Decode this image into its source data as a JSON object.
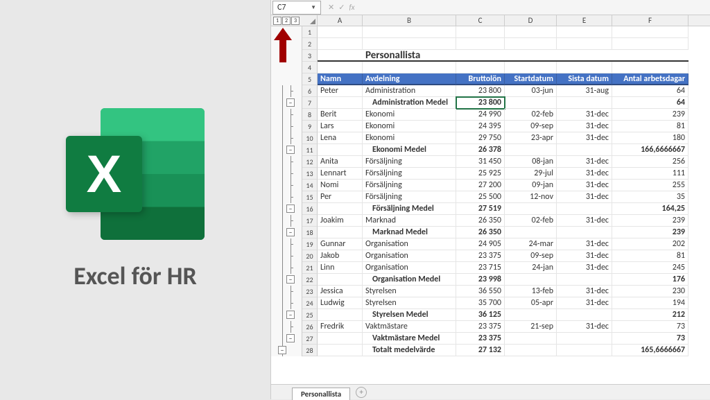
{
  "title": "Excel för HR",
  "logo_letter": "X",
  "namebox": "C7",
  "fx": {
    "cancel": "✕",
    "confirm": "✓",
    "fx": "fx"
  },
  "outline_levels": [
    "1",
    "2",
    "3"
  ],
  "columns": [
    "A",
    "B",
    "C",
    "D",
    "E",
    "F"
  ],
  "sheet_title": "Personallista",
  "headers": {
    "namn": "Namn",
    "avd": "Avdelning",
    "brutto": "Bruttolön",
    "start": "Startdatum",
    "sista": "Sista datum",
    "dagar": "Antal arbetsdagar"
  },
  "rows": [
    {
      "n": 1
    },
    {
      "n": 2
    },
    {
      "n": 3,
      "title": true
    },
    {
      "n": 4
    },
    {
      "n": 5,
      "hdr": true
    },
    {
      "n": 6,
      "a": "Peter",
      "b": "Administration",
      "c": "23 800",
      "d": "03-jun",
      "e": "31-aug",
      "f": "64"
    },
    {
      "n": 7,
      "sub": true,
      "b": "Administration Medel",
      "c": "23 800",
      "f": "64",
      "sel": true
    },
    {
      "n": 8,
      "a": "Berit",
      "b": "Ekonomi",
      "c": "24 990",
      "d": "02-feb",
      "e": "31-dec",
      "f": "239"
    },
    {
      "n": 9,
      "a": "Lars",
      "b": "Ekonomi",
      "c": "24 395",
      "d": "09-sep",
      "e": "31-dec",
      "f": "81"
    },
    {
      "n": 10,
      "a": "Lena",
      "b": "Ekonomi",
      "c": "29 750",
      "d": "23-apr",
      "e": "31-dec",
      "f": "180"
    },
    {
      "n": 11,
      "sub": true,
      "b": "Ekonomi Medel",
      "c": "26 378",
      "f": "166,6666667"
    },
    {
      "n": 12,
      "a": "Anita",
      "b": "Försäljning",
      "c": "31 450",
      "d": "08-jan",
      "e": "31-dec",
      "f": "256"
    },
    {
      "n": 13,
      "a": "Lennart",
      "b": "Försäljning",
      "c": "25 925",
      "d": "29-jul",
      "e": "31-dec",
      "f": "111"
    },
    {
      "n": 14,
      "a": "Nomi",
      "b": "Försäljning",
      "c": "27 200",
      "d": "09-jan",
      "e": "31-dec",
      "f": "255"
    },
    {
      "n": 15,
      "a": "Per",
      "b": "Försäljning",
      "c": "25 500",
      "d": "12-nov",
      "e": "31-dec",
      "f": "35"
    },
    {
      "n": 16,
      "sub": true,
      "b": "Försäljning Medel",
      "c": "27 519",
      "f": "164,25"
    },
    {
      "n": 17,
      "a": "Joakim",
      "b": "Marknad",
      "c": "26 350",
      "d": "02-feb",
      "e": "31-dec",
      "f": "239"
    },
    {
      "n": 18,
      "sub": true,
      "b": "Marknad Medel",
      "c": "26 350",
      "f": "239"
    },
    {
      "n": 19,
      "a": "Gunnar",
      "b": "Organisation",
      "c": "24 905",
      "d": "24-mar",
      "e": "31-dec",
      "f": "202"
    },
    {
      "n": 20,
      "a": "Jakob",
      "b": "Organisation",
      "c": "23 375",
      "d": "09-sep",
      "e": "31-dec",
      "f": "81"
    },
    {
      "n": 21,
      "a": "Linn",
      "b": "Organisation",
      "c": "23 715",
      "d": "24-jan",
      "e": "31-dec",
      "f": "245"
    },
    {
      "n": 22,
      "sub": true,
      "b": "Organisation Medel",
      "c": "23 998",
      "f": "176"
    },
    {
      "n": 23,
      "a": "Jessica",
      "b": "Styrelsen",
      "c": "36 550",
      "d": "13-feb",
      "e": "31-dec",
      "f": "230"
    },
    {
      "n": 24,
      "a": "Ludwig",
      "b": "Styrelsen",
      "c": "35 700",
      "d": "05-apr",
      "e": "31-dec",
      "f": "194"
    },
    {
      "n": 25,
      "sub": true,
      "b": "Styrelsen Medel",
      "c": "36 125",
      "f": "212"
    },
    {
      "n": 26,
      "a": "Fredrik",
      "b": "Vaktmästare",
      "c": "23 375",
      "d": "21-sep",
      "e": "31-dec",
      "f": "73"
    },
    {
      "n": 27,
      "sub": true,
      "b": "Vaktmästare Medel",
      "c": "23 375",
      "f": "73"
    },
    {
      "n": 28,
      "grand": true,
      "b": "Totalt medelvärde",
      "c": "27 132",
      "f": "165,6666667"
    }
  ],
  "tabs": {
    "active": "Personallista",
    "add": "+"
  }
}
